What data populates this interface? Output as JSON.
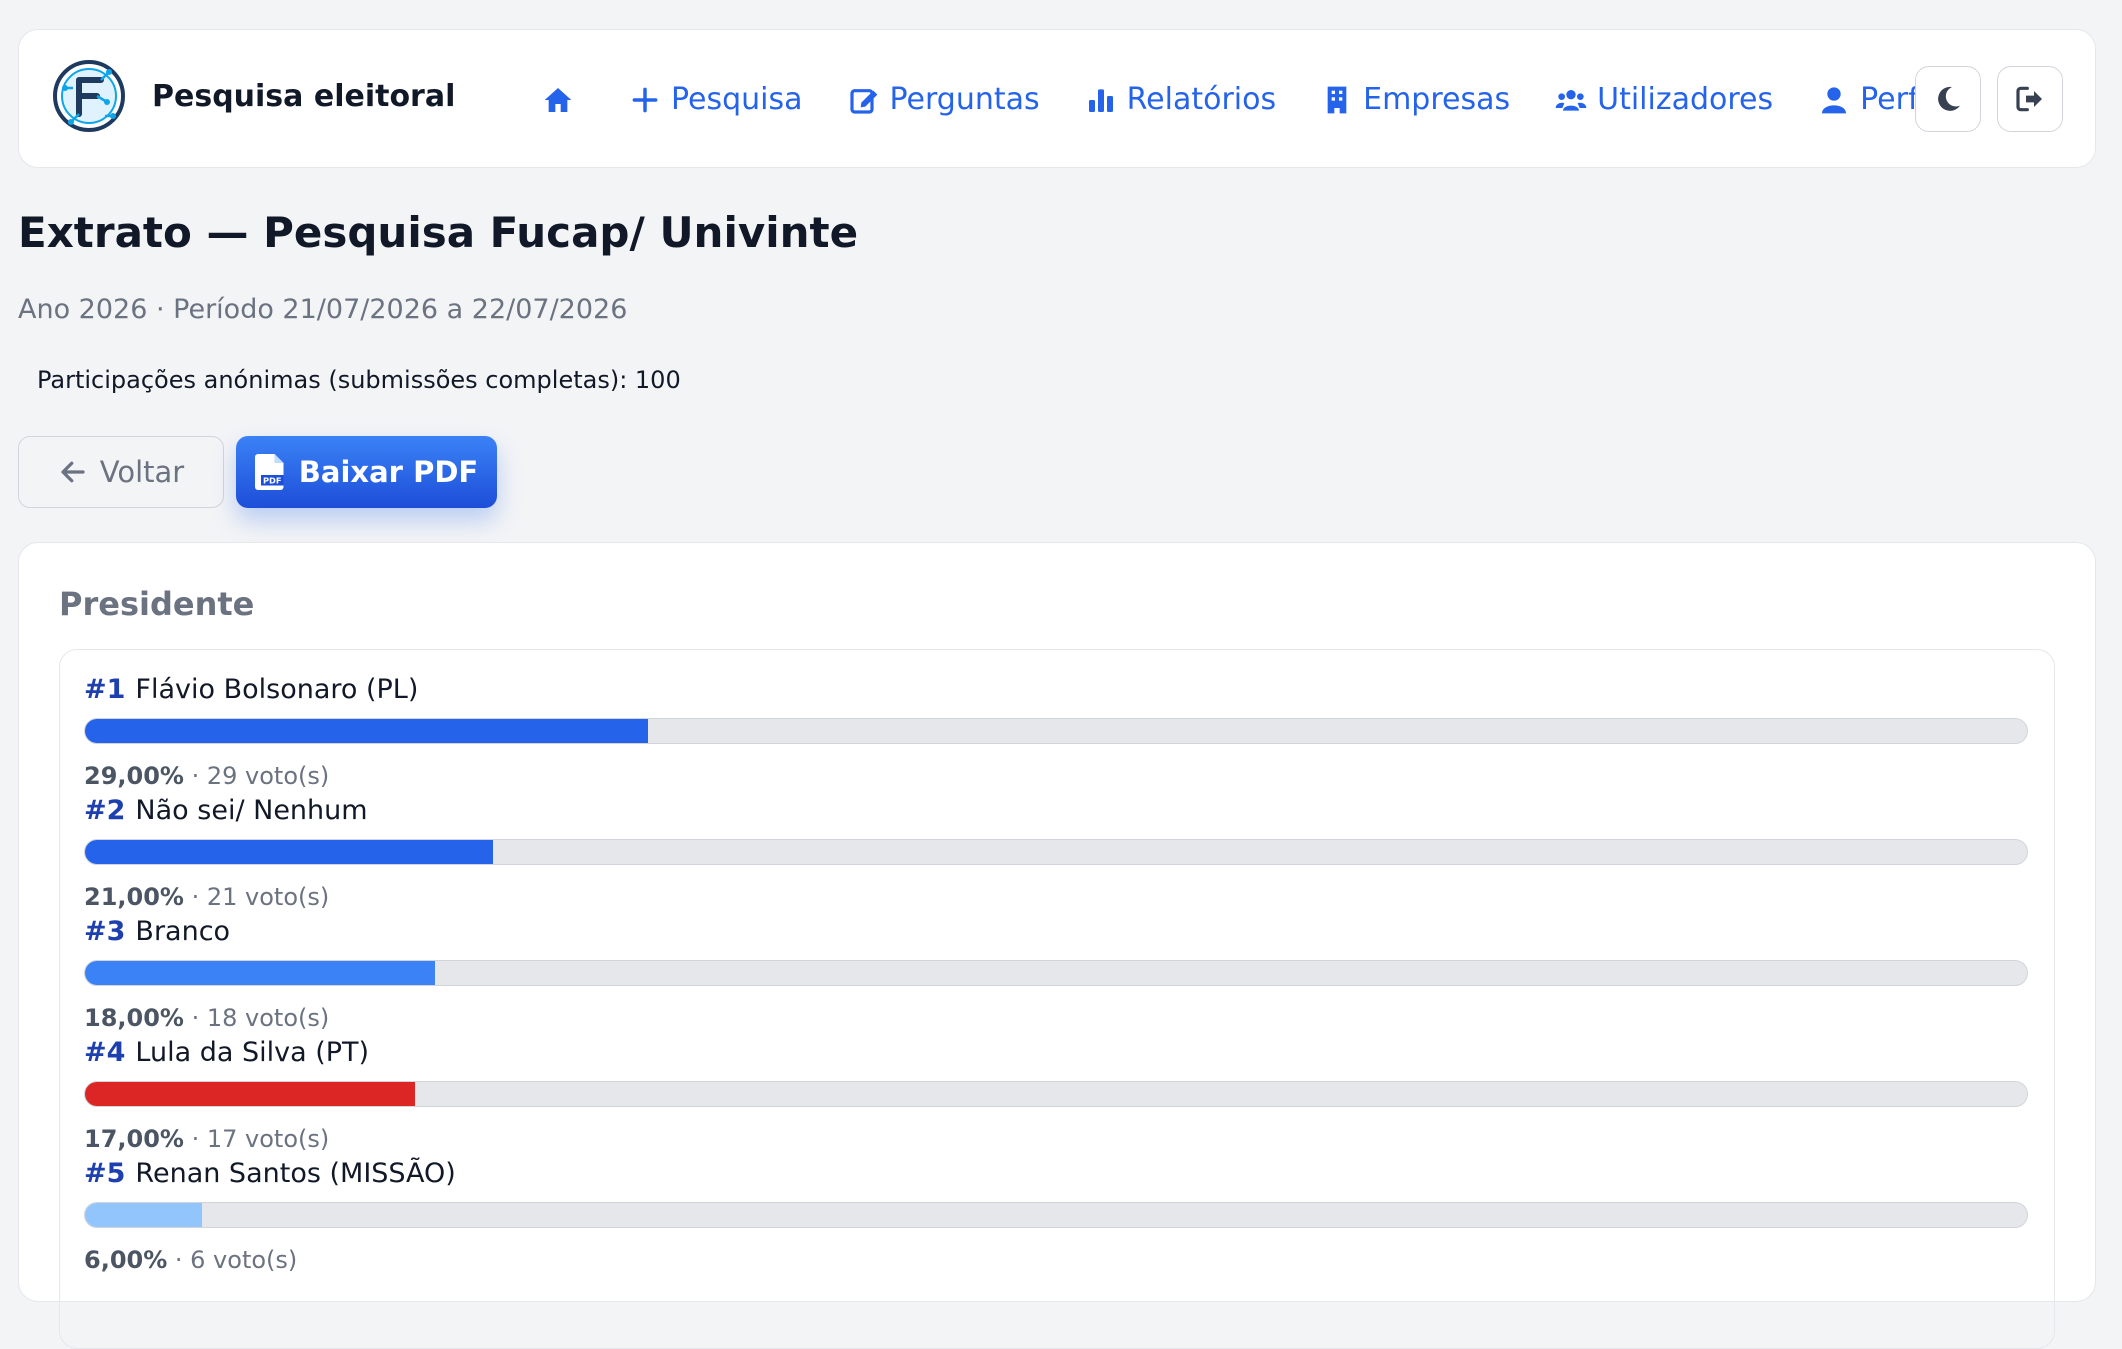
{
  "brand": {
    "name": "Pesquisa eleitoral",
    "logo_icon": "circuit-f-logo"
  },
  "nav": {
    "items": [
      {
        "label": "",
        "icon": "home-icon"
      },
      {
        "label": "Pesquisa",
        "icon": "plus-icon"
      },
      {
        "label": "Perguntas",
        "icon": "edit-icon"
      },
      {
        "label": "Relatórios",
        "icon": "chart-bars-icon"
      },
      {
        "label": "Empresas",
        "icon": "building-icon"
      },
      {
        "label": "Utilizadores",
        "icon": "users-icon"
      },
      {
        "label": "Perfil",
        "icon": "user-icon"
      }
    ],
    "accent_color": "#2563eb"
  },
  "page": {
    "title": "Extrato — Pesquisa Fucap/ Univinte",
    "subtitle": "Ano 2026 · Período 21/07/2026 a 22/07/2026",
    "participations": "Participações anónimas (submissões completas): 100"
  },
  "actions": {
    "back_label": "Voltar",
    "pdf_label": "Baixar PDF"
  },
  "question": {
    "title": "Presidente",
    "results": [
      {
        "rank": "#1",
        "name": "Flávio Bolsonaro (PL)",
        "percent_label": "29,00%",
        "votes_label": "29 voto(s)",
        "percent": 29,
        "color": "#2563eb"
      },
      {
        "rank": "#2",
        "name": "Não sei/ Nenhum",
        "percent_label": "21,00%",
        "votes_label": "21 voto(s)",
        "percent": 21,
        "color": "#2563eb"
      },
      {
        "rank": "#3",
        "name": "Branco",
        "percent_label": "18,00%",
        "votes_label": "18 voto(s)",
        "percent": 18,
        "color": "#3b82f6"
      },
      {
        "rank": "#4",
        "name": "Lula da Silva (PT)",
        "percent_label": "17,00%",
        "votes_label": "17 voto(s)",
        "percent": 17,
        "color": "#dc2626"
      },
      {
        "rank": "#5",
        "name": "Renan Santos (MISSÃO)",
        "percent_label": "6,00%",
        "votes_label": "6 voto(s)",
        "percent": 6,
        "color": "#93c5fd"
      }
    ]
  }
}
